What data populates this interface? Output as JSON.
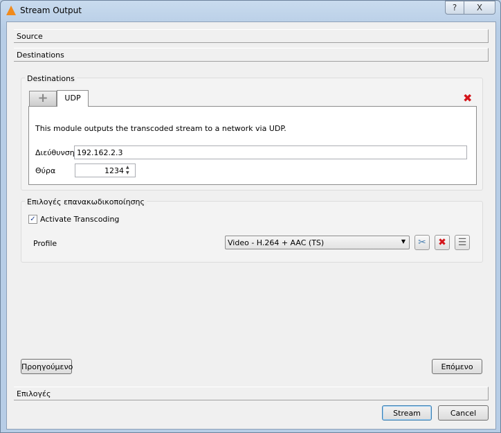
{
  "window": {
    "title": "Stream Output",
    "help": "?",
    "close": "X"
  },
  "sections": {
    "source": "Source",
    "destinations": "Destinations",
    "options": "Επιλογές"
  },
  "destinations": {
    "group_label": "Destinations",
    "tab_add": "+",
    "tab_udp": "UDP",
    "description": "This module outputs the transcoded stream to a network via UDP.",
    "address_label": "Διεύθυνση",
    "address_value": "192.162.2.3",
    "port_label": "Θύρα",
    "port_value": "1234"
  },
  "transcoding": {
    "group_label": "Επιλογές επανακωδικοποίησης",
    "activate_label": "Activate Transcoding",
    "activate_checked": true,
    "profile_label": "Profile",
    "profile_value": "Video - H.264 + AAC (TS)"
  },
  "buttons": {
    "previous": "Προηγούμενο",
    "next": "Επόμενο",
    "stream": "Stream",
    "cancel": "Cancel"
  },
  "colors": {
    "accent": "#3c7fb1",
    "delete": "#d4141a"
  }
}
